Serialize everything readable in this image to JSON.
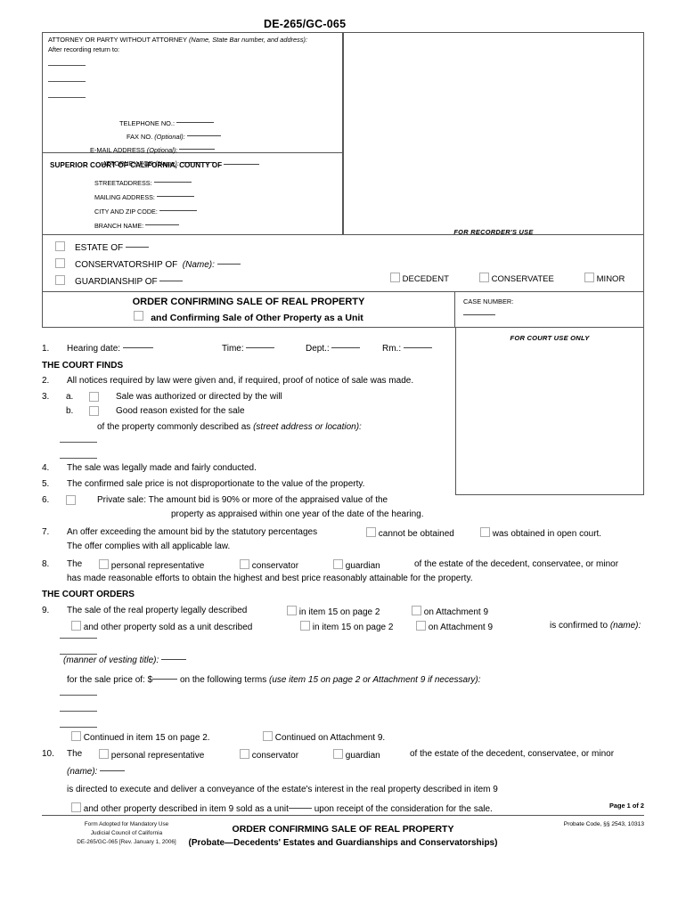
{
  "form_number": "DE-265/GC-065",
  "attorney_box": {
    "header_prefix": "ATTORNEY OR PARTY WITHOUT ATTORNEY ",
    "header_italic": "(Name, State Bar number, and address):",
    "after_recording": "After recording return to:",
    "fields": [
      {
        "label": "TELEPHONE NO.:",
        "italic": ""
      },
      {
        "label": "FAX NO. ",
        "italic": "(Optional):"
      },
      {
        "label": "E-MAIL ADDRESS ",
        "italic": "(Optional):"
      },
      {
        "label": "ATTORNEY FOR ",
        "italic": "(Name):"
      }
    ]
  },
  "court_box": {
    "title": "SUPERIOR COURT OF CALIFORNIA, COUNTY OF",
    "fields": [
      "STREETADDRESS:",
      "MAILING ADDRESS:",
      "CITY AND ZIP CODE:",
      "BRANCH NAME:"
    ]
  },
  "recorder_box": {
    "label": "FOR RECORDER'S USE"
  },
  "estate_block": {
    "rows": [
      {
        "label": "ESTATE OF",
        "italic": "",
        "has_rule": true
      },
      {
        "label": "CONSERVATORSHIP OF",
        "italic": "(Name):",
        "has_rule": true
      },
      {
        "label": "GUARDIANSHIP OF",
        "italic": "",
        "has_rule": true
      }
    ],
    "parties": [
      "DECEDENT",
      "CONSERVATEE",
      "MINOR"
    ]
  },
  "title_block": {
    "line1": "ORDER CONFIRMING SALE OF REAL PROPERTY",
    "line2": "and Confirming Sale of Other Property as a Unit"
  },
  "case_box": {
    "label": "CASE NUMBER:"
  },
  "court_use_box": {
    "label": "FOR COURT USE ONLY"
  },
  "body": {
    "item1": {
      "num": "1.",
      "hearing_label": "Hearing date:",
      "time_label": "Time:",
      "dept_label": "Dept.:",
      "rm_label": "Rm.:"
    },
    "heading_finds": "THE COURT FINDS",
    "item2": {
      "num": "2.",
      "text": "All notices required by law were given and, if required, proof of notice of sale was made."
    },
    "item3": {
      "num": "3.",
      "a_label": "a.",
      "a_text": "Sale was authorized or directed by the will",
      "b_label": "b.",
      "b_text": "Good reason existed for the sale",
      "desc_text": "of the property commonly described as ",
      "desc_italic": "(street address or location):"
    },
    "item4": {
      "num": "4.",
      "text": "The sale was legally made and fairly conducted."
    },
    "item5": {
      "num": "5.",
      "text": "The confirmed sale price is not disproportionate to the value of the property."
    },
    "item6": {
      "num": "6.",
      "line1": "Private sale:   The amount bid is 90% or more of the appraised value of the",
      "line2": "property as appraised within one year of the date of the hearing."
    },
    "item7": {
      "num": "7.",
      "line1_a": "An offer exceeding the amount bid by the statutory percentages",
      "opt1": "cannot be obtained",
      "opt2": "was obtained in open court.",
      "line2": "The offer complies with all applicable law."
    },
    "item8": {
      "num": "8.",
      "the": "The",
      "opt1": "personal representative",
      "opt2": "conservator",
      "opt3": "guardian",
      "tail": "of the estate of the decedent, conservatee, or minor",
      "line2": "has made reasonable efforts to obtain the highest and best price reasonably attainable for the property."
    },
    "heading_orders": "THE COURT ORDERS",
    "item9": {
      "num": "9.",
      "line1_a": "The sale of the real property legally described",
      "line1_opt1": "in item 15 on page 2",
      "line1_opt2": "on Attachment 9",
      "line2_a": "and other property sold as a unit described",
      "line2_opt1": "in item 15 on page 2",
      "line2_opt2": "on Attachment 9",
      "line2_tail": "is confirmed to ",
      "line2_tail_italic": "(name):",
      "vesting_italic": "(manner of vesting title):",
      "price_a": "for the sale price of:  $",
      "price_b": "on the following terms ",
      "price_italic": "(use item 15 on page 2 or Attachment 9 if necessary):",
      "cont_item15": "Continued in item 15 on page 2.",
      "cont_attach": "Continued on Attachment 9."
    },
    "item10": {
      "num": "10.",
      "the": "The",
      "opt1": "personal representative",
      "opt2": "conservator",
      "opt3": "guardian",
      "tail": "of the estate of the decedent, conservatee, or minor",
      "name_italic": "(name):",
      "directed": "is directed to execute and deliver a conveyance of the estate's interest in the real property described in item 9",
      "unit_a": "and other property described in item 9 sold as a unit",
      "unit_b": "upon receipt of the consideration for the sale."
    },
    "page_of": "Page 1 of 2"
  },
  "footer": {
    "left_line1": "Form Adopted for Mandatory Use",
    "left_line2": "Judicial Council of California",
    "left_line3": "DE-265/GC-065 [Rev. January 1, 2006]",
    "center_line1": "ORDER CONFIRMING SALE OF REAL PROPERTY",
    "center_line2": "(Probate—Decedents' Estates and Guardianships and Conservatorships)",
    "right": "Probate Code, §§ 2543, 10313"
  }
}
